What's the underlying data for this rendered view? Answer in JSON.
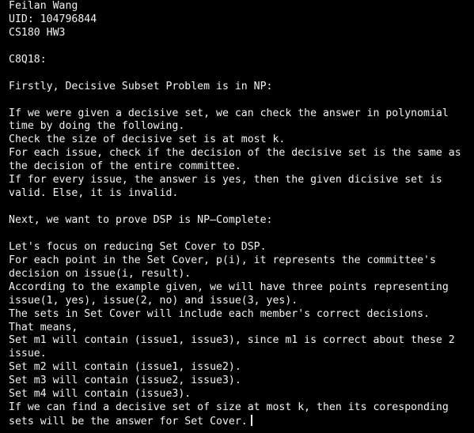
{
  "editor": {
    "lines": [
      "Feilan Wang",
      "UID: 104796844",
      "CS180 HW3",
      "",
      "C8Q18:",
      "",
      "Firstly, Decisive Subset Problem is in NP:",
      "",
      "If we were given a decisive set, we can check the answer in polynomial",
      "time by doing the following.",
      "Check the size of decisive set is at most k.",
      "For each issue, check if the decision of the decisive set is the same as",
      "the decision of the entire committee.",
      "If for every issue, the answer is yes, then the given dicisive set is",
      "valid. Else, it is invalid.",
      "",
      "Next, we want to prove DSP is NP—Complete:",
      "",
      "Let's focus on reducing Set Cover to DSP.",
      "For each point in the Set Cover, p(i), it represents the committee's",
      "decision on issue(i, result).",
      "According to the example given, we will have three points representing",
      "issue(1, yes), issue(2, no) and issue(3, yes).",
      "The sets in Set Cover will include each member's correct decisions.",
      "That means,",
      "Set m1 will contain (issue1, issue3), since m1 is correct about these 2",
      "issue.",
      "Set m2 will contain (issue1, issue2).",
      "Set m3 will contain (issue2, issue3).",
      "Set m4 will contain (issue3).",
      "If we can find a decisive set of size at most k, then its coresponding",
      "sets will be the answer for Set Cover."
    ]
  },
  "colors": {
    "background": "#000000",
    "text": "#f2f2f2"
  }
}
